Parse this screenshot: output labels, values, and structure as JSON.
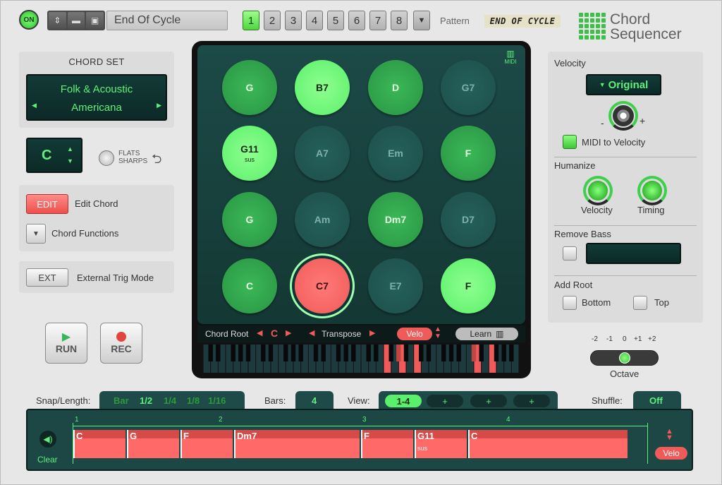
{
  "top": {
    "on_label": "ON",
    "preset_name": "End Of Cycle",
    "patterns": [
      "1",
      "2",
      "3",
      "4",
      "5",
      "6",
      "7",
      "8"
    ],
    "pattern_label": "Pattern",
    "pattern_name": "END OF CYCLE",
    "logo_line1": "Chord",
    "logo_line2": "Sequencer"
  },
  "chord_set": {
    "title": "CHORD SET",
    "line1": "Folk & Acoustic",
    "line2": "Americana"
  },
  "key": {
    "value": "C",
    "flats": "FLATS",
    "sharps": "SHARPS"
  },
  "edit": {
    "edit_btn": "EDIT",
    "edit_label": "Edit Chord",
    "functions_label": "Chord Functions"
  },
  "ext": {
    "btn": "EXT",
    "label": "External Trig Mode"
  },
  "transport": {
    "run": "RUN",
    "rec": "REC"
  },
  "pads": [
    {
      "label": "G",
      "sub": "",
      "state": "mid"
    },
    {
      "label": "B7",
      "sub": "",
      "state": "bright"
    },
    {
      "label": "D",
      "sub": "",
      "state": "mid"
    },
    {
      "label": "G7",
      "sub": "",
      "state": "dark"
    },
    {
      "label": "G11",
      "sub": "sus",
      "state": "bright"
    },
    {
      "label": "A7",
      "sub": "",
      "state": "dark"
    },
    {
      "label": "Em",
      "sub": "",
      "state": "dark"
    },
    {
      "label": "F",
      "sub": "",
      "state": "mid"
    },
    {
      "label": "G",
      "sub": "",
      "state": "mid"
    },
    {
      "label": "Am",
      "sub": "",
      "state": "dark"
    },
    {
      "label": "Dm7",
      "sub": "",
      "state": "mid"
    },
    {
      "label": "D7",
      "sub": "",
      "state": "dark"
    },
    {
      "label": "C",
      "sub": "",
      "state": "mid"
    },
    {
      "label": "C7",
      "sub": "",
      "state": "red"
    },
    {
      "label": "E7",
      "sub": "",
      "state": "dark"
    },
    {
      "label": "F",
      "sub": "",
      "state": "bright"
    }
  ],
  "pad_bar": {
    "midi": "MIDI",
    "chord_root_label": "Chord Root",
    "chord_root_value": "C",
    "transpose_label": "Transpose",
    "velo": "Velo",
    "learn": "Learn"
  },
  "velocity": {
    "title": "Velocity",
    "mode": "Original",
    "minus": "-",
    "plus": "+",
    "midi_to_velocity": "MIDI to Velocity"
  },
  "humanize": {
    "title": "Humanize",
    "velocity": "Velocity",
    "timing": "Timing"
  },
  "remove_bass": {
    "title": "Remove Bass"
  },
  "add_root": {
    "title": "Add Root",
    "bottom": "Bottom",
    "top": "Top"
  },
  "octave": {
    "ticks": [
      "-2",
      "-1",
      "0",
      "+1",
      "+2"
    ],
    "label": "Octave",
    "value": 0
  },
  "bottom_bar": {
    "snap_label": "Snap/Length:",
    "snap_options": [
      "Bar",
      "1/2",
      "1/4",
      "1/8",
      "1/16"
    ],
    "snap_active": "1/2",
    "bars_label": "Bars:",
    "bars_value": "4",
    "view_label": "View:",
    "view_active": "1-4",
    "view_plus": [
      "+",
      "+",
      "+"
    ],
    "shuffle_label": "Shuffle:",
    "shuffle_value": "Off"
  },
  "timeline": {
    "clear": "Clear",
    "velo": "Velo",
    "bar_numbers": [
      "1",
      "2",
      "3",
      "4"
    ],
    "segments": [
      {
        "label": "C",
        "sub": ""
      },
      {
        "label": "G",
        "sub": ""
      },
      {
        "label": "F",
        "sub": ""
      },
      {
        "label": "Dm7",
        "sub": ""
      },
      {
        "label": "F",
        "sub": ""
      },
      {
        "label": "G11",
        "sub": "sus"
      },
      {
        "label": "C",
        "sub": ""
      }
    ]
  },
  "colors": {
    "accent_green": "#5af06a",
    "pad_red": "#f05a58",
    "lcd_bg": "#123a36"
  }
}
